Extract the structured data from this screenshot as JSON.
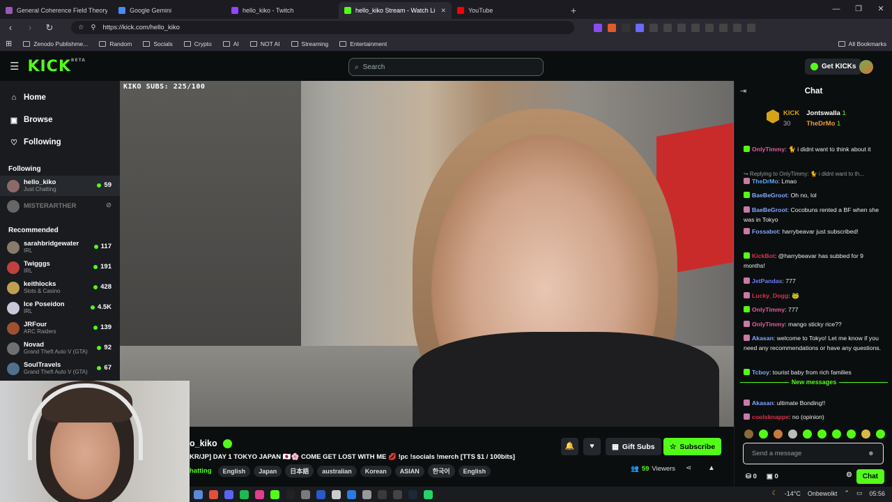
{
  "browser": {
    "tabs": [
      {
        "title": "General Coherence Field Theory (GCF",
        "color": "#9b59b6"
      },
      {
        "title": "Google Gemini",
        "color": "#4a8af4"
      },
      {
        "title": "hello_kiko - Twitch",
        "color": "#9146ff"
      },
      {
        "title": "hello_kiko Stream - Watch Li",
        "color": "#53fc18",
        "active": true
      },
      {
        "title": "YouTube",
        "color": "#ff0000"
      }
    ],
    "new_tab": "+",
    "url": "https://kick.com/hello_kiko",
    "bookmarks": [
      "Zenodo Publishme...",
      "Random",
      "Socials",
      "Crypto",
      "AI",
      "NOT AI",
      "Streaming",
      "Entertainment"
    ],
    "all_bookmarks": "All Bookmarks"
  },
  "kick": {
    "logo": "KICK",
    "logo_beta": "BETA",
    "search_placeholder": "Search",
    "get_kicks": "Get KICKs",
    "accent": "#53fc18"
  },
  "sidebar": {
    "nav": [
      {
        "label": "Home",
        "icon": "home-icon"
      },
      {
        "label": "Browse",
        "icon": "browse-icon"
      },
      {
        "label": "Following",
        "icon": "heart-icon"
      }
    ],
    "following_title": "Following",
    "following": [
      {
        "name": "hello_kiko",
        "category": "Just Chatting",
        "viewers": "59",
        "color": "#8a6a6a"
      },
      {
        "name": "MISTERARTHER",
        "category": "",
        "viewers": "",
        "color": "#666"
      }
    ],
    "recommended_title": "Recommended",
    "recommended": [
      {
        "name": "sarahbridgewater",
        "category": "IRL",
        "viewers": "117",
        "color": "#8a7a6a"
      },
      {
        "name": "Twigggs",
        "category": "IRL",
        "viewers": "191",
        "color": "#c04040"
      },
      {
        "name": "keithlocks",
        "category": "Slots & Casino",
        "viewers": "428",
        "color": "#c0a050"
      },
      {
        "name": "Ice Poseidon",
        "category": "IRL",
        "viewers": "4.5K",
        "color": "#c8c8d8"
      },
      {
        "name": "JRFour",
        "category": "ARC Raiders",
        "viewers": "139",
        "color": "#a05030"
      },
      {
        "name": "Novad",
        "category": "Grand Theft Auto V (GTA)",
        "viewers": "92",
        "color": "#707070"
      },
      {
        "name": "SoulTravels",
        "category": "Grand Theft Auto V (GTA)",
        "viewers": "67",
        "color": "#507090"
      }
    ]
  },
  "video": {
    "overlay_text": "KIKO SUBS: 225/100"
  },
  "stream": {
    "channel": "o_kiko",
    "title": "KR/JP] DAY 1 TOKYO JAPAN 🇯🇵🌸 COME GET LOST WITH ME 💋 !pc !socials !merch [TTS $1 / 100bits]",
    "category": "hatting",
    "tags": [
      "English",
      "Japan",
      "日本語",
      "australian",
      "Korean",
      "ASIAN",
      "한국어",
      "English"
    ],
    "gift_subs": "Gift Subs",
    "subscribe": "Subscribe",
    "viewers_count": "59",
    "viewers_label": "Viewers"
  },
  "chat": {
    "title": "Chat",
    "pinned": {
      "kick_label": "KICK",
      "kick_count": "30",
      "user1": "Jontswalla",
      "user1_count": "1",
      "user2": "TheDrMo",
      "user2_count": "1"
    },
    "messages": [
      {
        "user": "OnlyTimmy",
        "color": "#e05c9c",
        "text": ": 🐈 i didnt want to think about it"
      },
      {
        "user": "",
        "color": "#999",
        "text": "↪ Replying to OnlyTimmy: 🐈 i didnt want to th..."
      },
      {
        "user": "TheDrMo",
        "color": "#56a8ff",
        "text": ": Lmao"
      },
      {
        "user": "BaeBeGroot",
        "color": "#7fa8ff",
        "text": ": Oh no, lol"
      },
      {
        "user": "BaeBeGroot",
        "color": "#7fa8ff",
        "text": ": Cocobuns rented a BF when she was in Tokyo"
      },
      {
        "user": "Fossabot",
        "color": "#7fa8ff",
        "text": ": harrybeavar just subscribed!"
      },
      {
        "user": "KickBot",
        "color": "#e0304c",
        "text": ": @harrybeavar has subbed for 9 months!"
      },
      {
        "user": "JetPandas",
        "color": "#6c7dff",
        "text": ": 777"
      },
      {
        "user": "Lucky_Dogg",
        "color": "#e0304c",
        "text": ": 🐸"
      },
      {
        "user": "OnlyTimmy",
        "color": "#e05c9c",
        "text": ": 777"
      },
      {
        "user": "OnlyTimmy",
        "color": "#e05c9c",
        "text": ": mango sticky rice??"
      },
      {
        "user": "Akasan",
        "color": "#7fa8ff",
        "text": ": welcome to Tokyo! Let me know if you need any recommendations or have any questions."
      },
      {
        "user": "Tcboy",
        "color": "#7fa8ff",
        "text": ": tourist baby from rich families"
      },
      {
        "user": "Akasan",
        "color": "#7fa8ff",
        "text": ": ultimate Bonding!!"
      },
      {
        "user": "coolsknappe",
        "color": "#e0304c",
        "text": ": no (opinion)"
      }
    ],
    "new_messages": "New messages",
    "input_placeholder": "Send a message",
    "foot_count1": "0",
    "foot_count2": "0",
    "send": "Chat"
  },
  "taskbar": {
    "weather": "-14°C",
    "weather_text": "Onbewolkt",
    "time": "05:56"
  }
}
